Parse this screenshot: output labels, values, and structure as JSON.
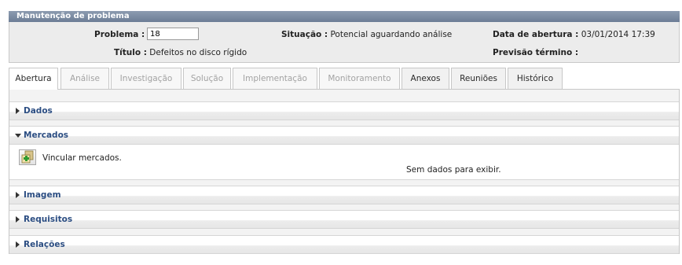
{
  "panel": {
    "title": "Manutenção de problema"
  },
  "header": {
    "problema_label": "Problema :",
    "problema_value": "18",
    "situacao_label": "Situação :",
    "situacao_value": "Potencial aguardando análise",
    "data_abertura_label": "Data de abertura :",
    "data_abertura_value": "03/01/2014 17:39",
    "titulo_label": "Título :",
    "titulo_value": "Defeitos no disco rígido",
    "previsao_label": "Previsão término :",
    "previsao_value": ""
  },
  "tabs": [
    {
      "label": "Abertura",
      "state": "active"
    },
    {
      "label": "Análise",
      "state": "disabled"
    },
    {
      "label": "Investigação",
      "state": "disabled"
    },
    {
      "label": "Solução",
      "state": "disabled"
    },
    {
      "label": "Implementação",
      "state": "disabled"
    },
    {
      "label": "Monitoramento",
      "state": "disabled"
    },
    {
      "label": "Anexos",
      "state": "enabled"
    },
    {
      "label": "Reuniões",
      "state": "enabled"
    },
    {
      "label": "Histórico",
      "state": "enabled"
    }
  ],
  "sections": [
    {
      "label": "Dados",
      "expanded": false
    },
    {
      "label": "Mercados",
      "expanded": true
    },
    {
      "label": "Imagem",
      "expanded": false
    },
    {
      "label": "Requisitos",
      "expanded": false
    },
    {
      "label": "Relações",
      "expanded": false
    }
  ],
  "mercados": {
    "add_icon": "add-link-icon",
    "add_label": "Vincular mercados.",
    "empty_text": "Sem dados para exibir."
  },
  "colors": {
    "title_bar": "#7b8aa3",
    "section_label": "#2b4d82",
    "header_bg": "#ececec"
  }
}
